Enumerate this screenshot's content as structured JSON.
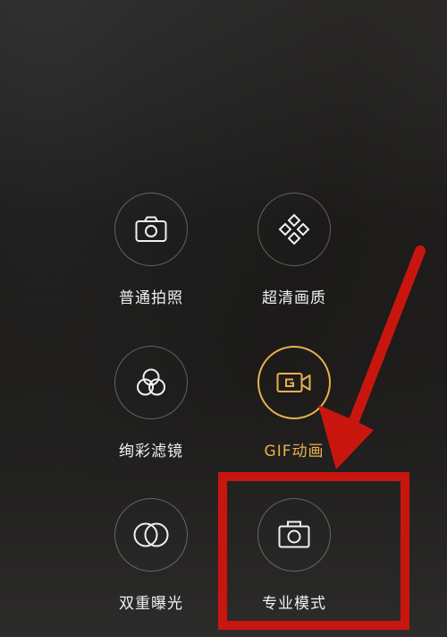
{
  "modes": [
    {
      "id": "normal",
      "label": "普通拍照",
      "icon": "camera-icon"
    },
    {
      "id": "hd",
      "label": "超清画质",
      "icon": "diamond-grid-icon"
    },
    {
      "id": "filter",
      "label": "绚彩滤镜",
      "icon": "color-filter-icon"
    },
    {
      "id": "gif",
      "label": "GIF动画",
      "icon": "gif-video-icon",
      "active": true
    },
    {
      "id": "double",
      "label": "双重曝光",
      "icon": "double-exposure-icon"
    },
    {
      "id": "pro",
      "label": "专业模式",
      "icon": "pro-camera-icon"
    }
  ],
  "colors": {
    "active": "#e9b04e",
    "annotation": "#c8160f",
    "label": "#f0f0f0"
  }
}
